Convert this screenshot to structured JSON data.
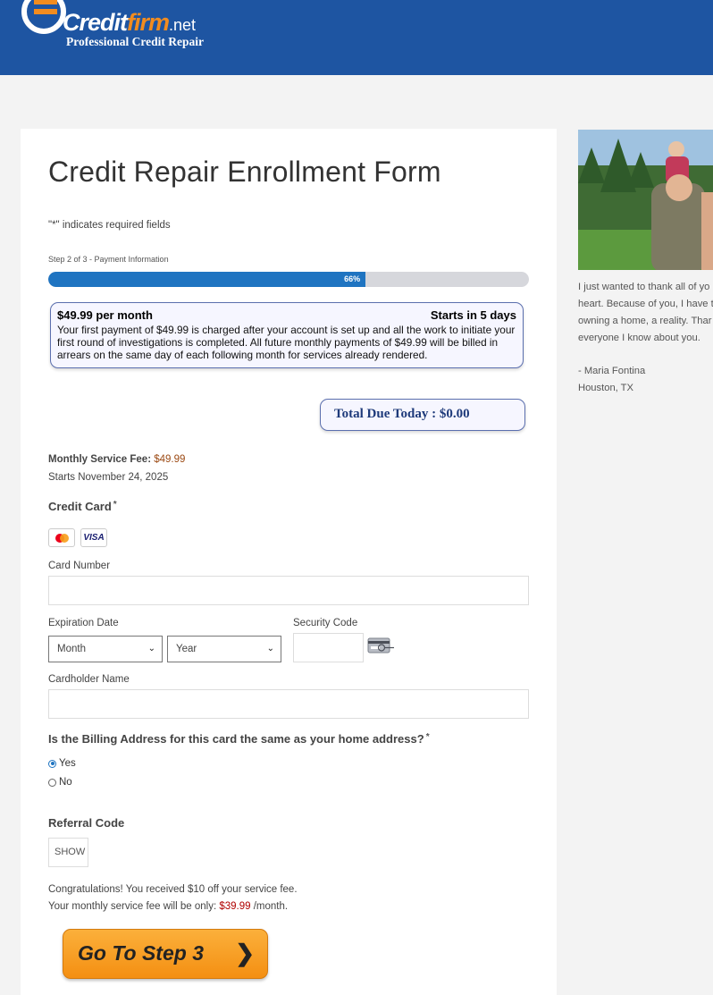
{
  "header": {
    "logo": {
      "brand_main": "Credit",
      "brand_accent": "firm",
      "brand_tld": ".net",
      "tagline": "Professional Credit Repair"
    }
  },
  "form": {
    "title": "Credit Repair Enrollment Form",
    "required_note": "\"*\" indicates required fields",
    "step_label": "Step 2 of 3 - Payment Information",
    "progress": {
      "percent_label": "66%",
      "value": 0.66
    },
    "info_box": {
      "price_heading": "$49.99 per month",
      "starts_heading": "Starts in 5 days",
      "body": "Your first payment of $49.99 is charged after your account is set up and all the work to initiate your first round of investigations is completed. All future monthly payments of $49.99  will be billed in arrears on the same day of each following month for services already rendered."
    },
    "total_due": "Total Due Today : $0.00",
    "fee": {
      "label": "Monthly Service Fee:",
      "value": "$49.99"
    },
    "starts_date": "Starts November 24, 2025",
    "credit_card": {
      "label": "Credit Card",
      "required": "*",
      "icons": [
        "mastercard-icon",
        "visa-icon"
      ],
      "visa_text": "VISA",
      "card_number_label": "Card Number",
      "expiration_label": "Expiration Date",
      "month_value": "Month",
      "year_value": "Year",
      "security_label": "Security Code",
      "cardholder_label": "Cardholder Name"
    },
    "billing": {
      "question": "Is the Billing Address for this card the same as your home address?",
      "required": "*",
      "options": [
        {
          "label": "Yes",
          "selected": true
        },
        {
          "label": "No",
          "selected": false
        }
      ]
    },
    "referral": {
      "label": "Referral Code",
      "value": "SHOW"
    },
    "congrats": {
      "line1": "Congratulations! You received $10 off your service fee.",
      "line2_prefix": "Your monthly service fee will be only:",
      "line2_price": "$39.99",
      "line2_suffix": "/month."
    },
    "submit_label": "Go To Step 3"
  },
  "sidebar": {
    "testimonial_lines": [
      "I just wanted to thank all of yo",
      "heart. Because of you, I have t",
      "owning a home, a reality. Thar",
      "everyone I know about you."
    ],
    "author": " - Maria Fontina",
    "location": "Houston, TX"
  },
  "colors": {
    "header_bg": "#1e55a2",
    "progress_fill": "#1f74c1",
    "button_orange": "#f7a02a",
    "price_brown": "#9c4a14",
    "price_red": "#b00000"
  }
}
